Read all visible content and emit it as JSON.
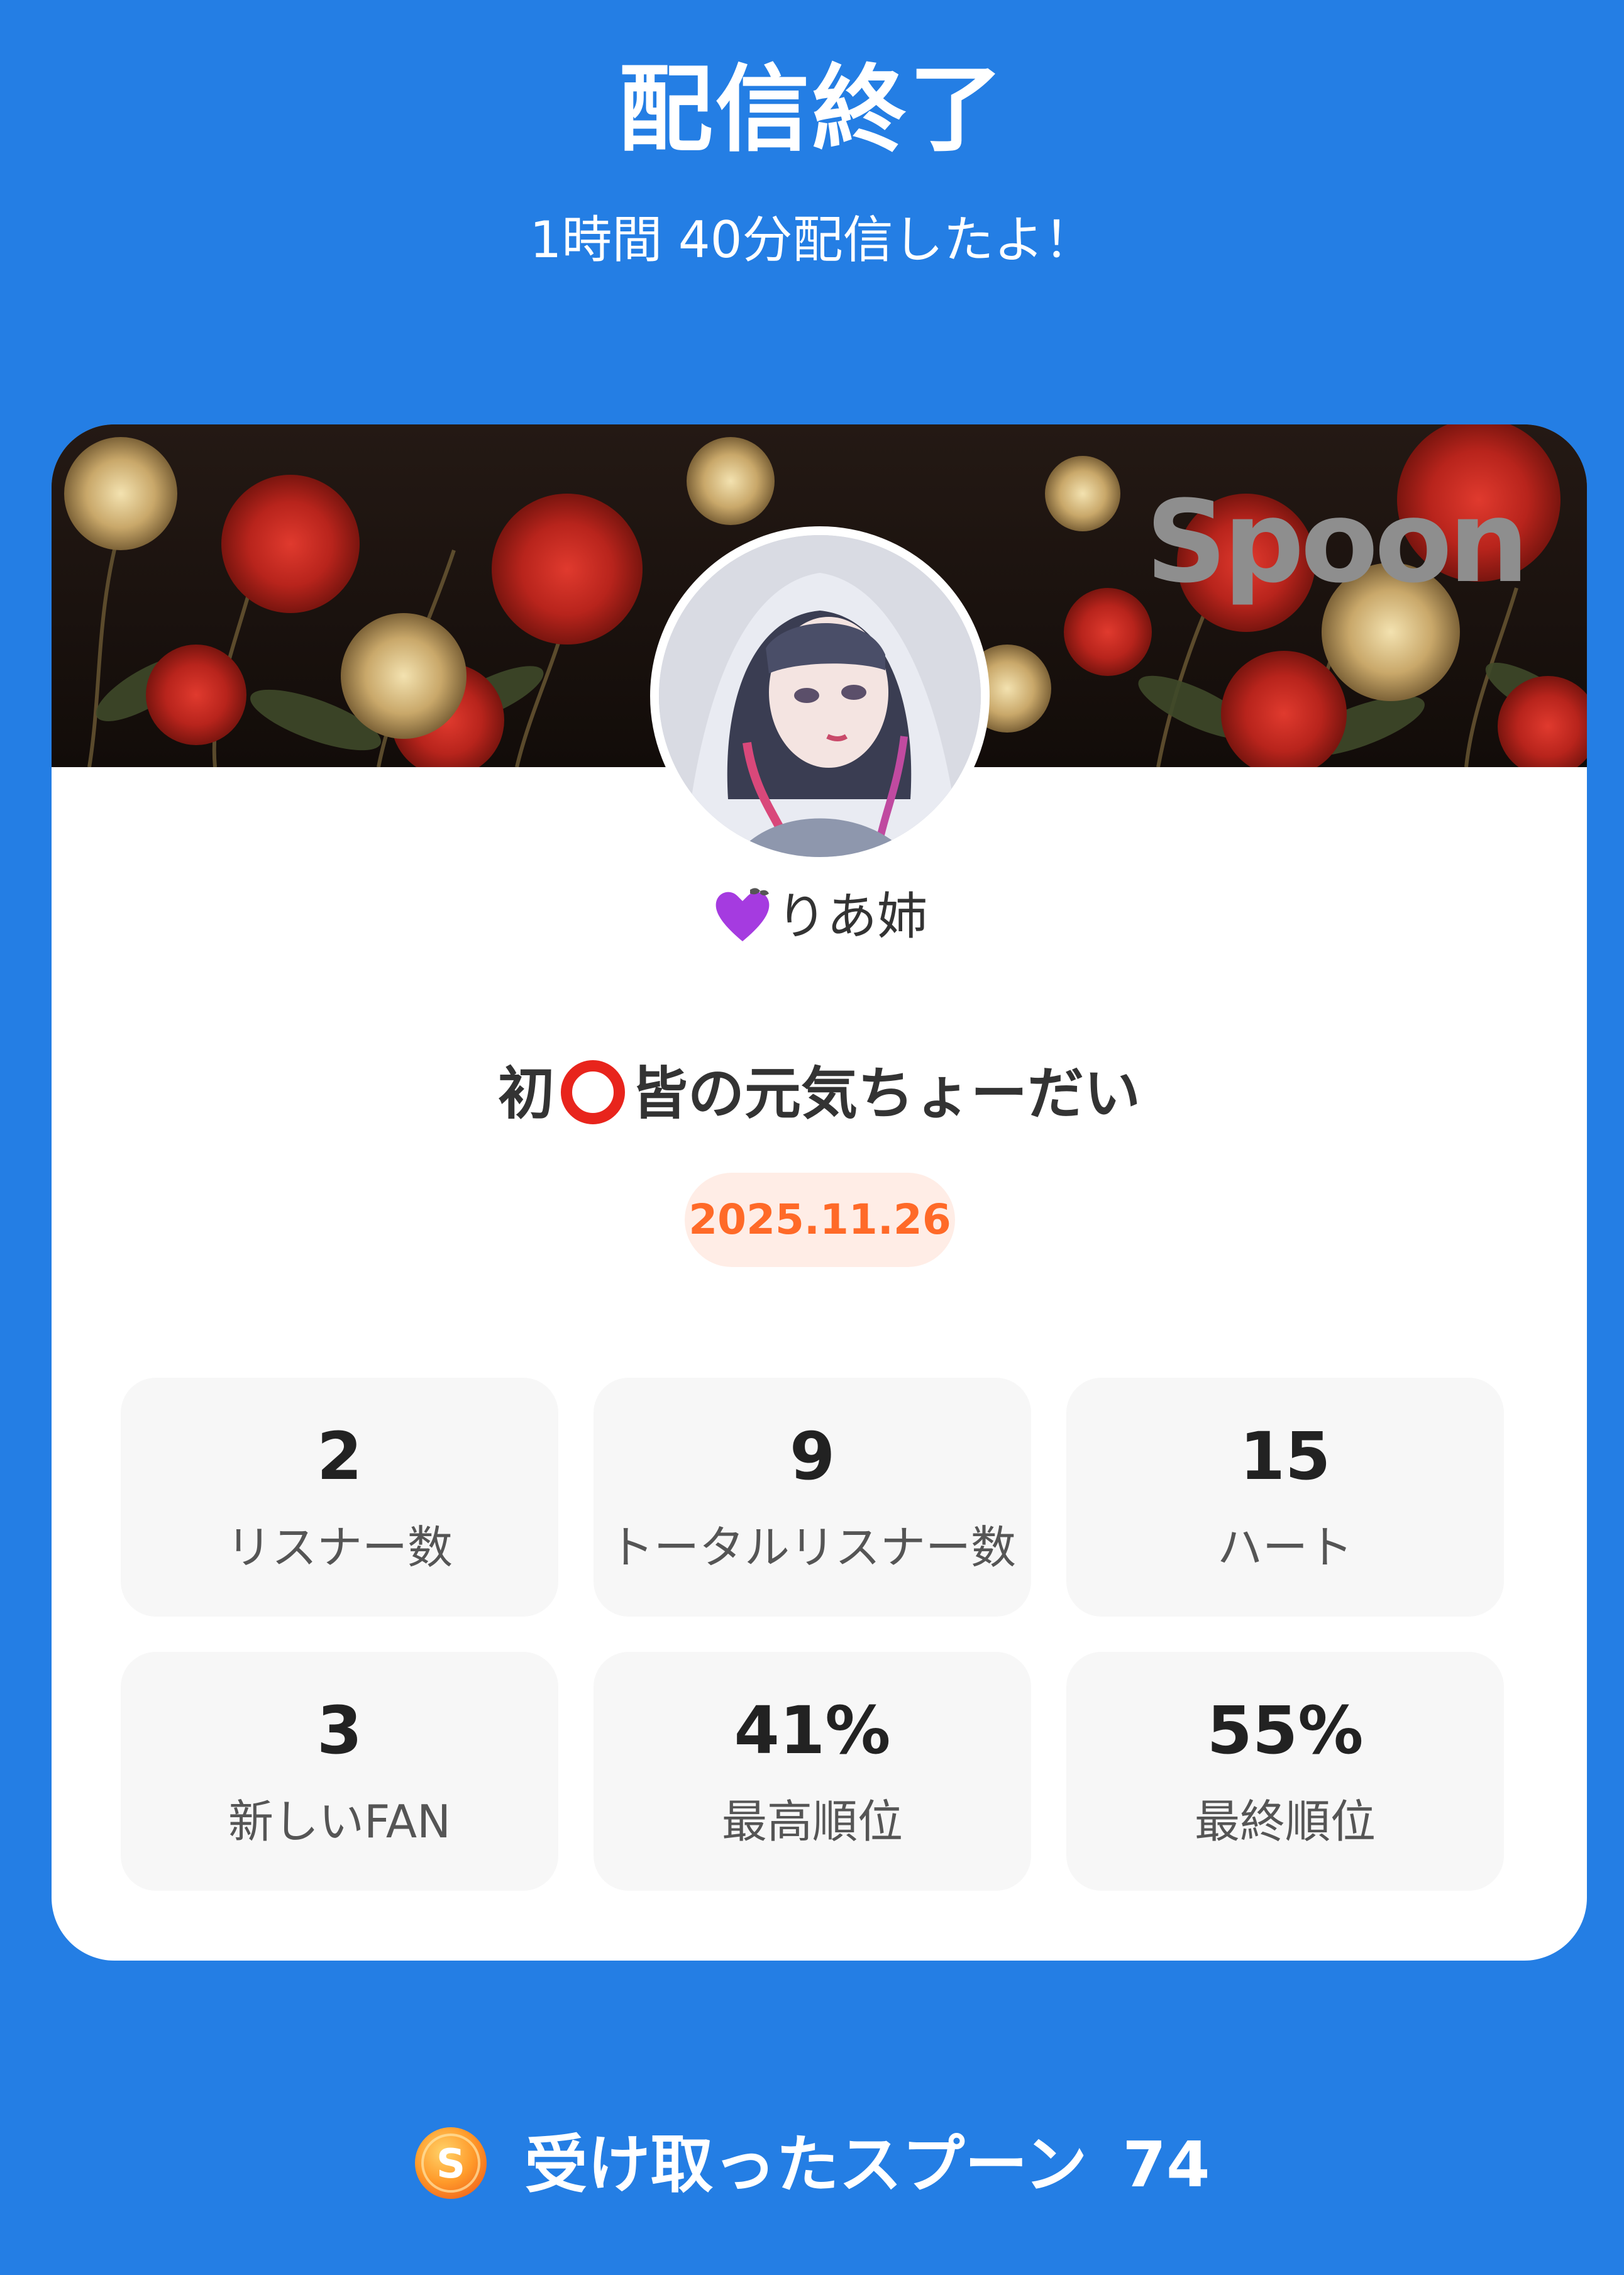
{
  "header": {
    "title": "配信終了",
    "subtitle": "1時間 40分配信したよ！"
  },
  "card": {
    "logo_text": "Spoon",
    "username": "りあ姉",
    "username_icon": "purple-heart-ribbon-icon",
    "stream_title_prefix": "初",
    "stream_title_icon": "red-circle-icon",
    "stream_title_suffix": "皆の元気ちょーだい",
    "date": "2025.11.26"
  },
  "stats": [
    {
      "value": "2",
      "label": "リスナー数"
    },
    {
      "value": "9",
      "label": "トータルリスナー数"
    },
    {
      "value": "15",
      "label": "ハート"
    },
    {
      "value": "3",
      "label": "新しいFAN"
    },
    {
      "value": "41%",
      "label": "最高順位"
    },
    {
      "value": "55%",
      "label": "最終順位"
    }
  ],
  "footer": {
    "spoons_label": "受け取ったスプーン",
    "spoons_count": "74",
    "coin_icon": "spoon-coin-icon"
  },
  "colors": {
    "background": "#247ee4",
    "card": "#ffffff",
    "stat_box": "#f7f7f7",
    "date_text": "#ff6a28",
    "date_bg": "#ffede6"
  }
}
